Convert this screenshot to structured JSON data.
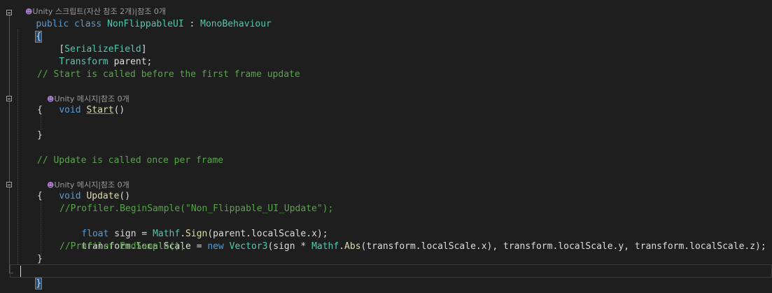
{
  "codelens": {
    "top_partial": "Unity 스크립트(자산 참조 2개)|참조 0개",
    "start": "Unity 메시지|참조 0개",
    "update": "Unity 메시지|참조 0개"
  },
  "code": {
    "l_class": [
      "public",
      "class",
      "NonFlippableUI",
      ":",
      "MonoBehaviour"
    ],
    "l_open": "{",
    "l_attr": [
      "[",
      "SerializeField",
      "]"
    ],
    "l_field": [
      "Transform",
      "parent;"
    ],
    "l_comment_start": "// Start is called before the first frame update",
    "l_start_sig": [
      "void",
      "Start",
      "()"
    ],
    "l_start_open": "{",
    "l_start_close": "}",
    "l_comment_update": "// Update is called once per frame",
    "l_update_sig": [
      "void",
      "Update",
      "()"
    ],
    "l_update_open": "{",
    "l_profiler_begin": "//Profiler.BeginSample(\"Non_Flippable_UI_Update\");",
    "l_float": [
      "float",
      "sign",
      "=",
      "Mathf",
      ".",
      "Sign",
      "(parent.localScale.x);"
    ],
    "l_transform": [
      "transform.localScale",
      "=",
      "new",
      "Vector3",
      "(",
      "sign",
      "*",
      "Mathf",
      ".",
      "Abs",
      "(transform.localScale.x), transform.localScale.y, transform.localScale.z);"
    ],
    "l_profiler_end": "//Profiler.EndSample();",
    "l_update_close": "}",
    "l_close": "}"
  },
  "icons": {
    "codelens": "codelens-reference-icon",
    "fold": "fold-collapse-icon"
  },
  "colors": {
    "background": "#1e1e1e",
    "keyword": "#569cd6",
    "type": "#4ec9b0",
    "comment": "#57a64a",
    "method": "#dcdcaa",
    "text": "#dcdcdc"
  }
}
